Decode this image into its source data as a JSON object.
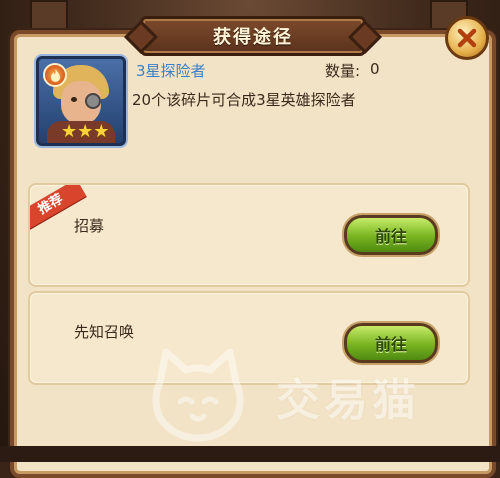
{
  "dialog": {
    "title": "获得途径",
    "close_icon": "close-x-icon"
  },
  "item": {
    "name": "3星探险者",
    "quantity_label": "数量:",
    "quantity_value": "0",
    "description": "20个该碎片可合成3星英雄探险者",
    "stars": 3,
    "element_icon": "fire-icon"
  },
  "sources": [
    {
      "label": "招募",
      "button": "前往",
      "recommended": true,
      "ribbon": "推荐"
    },
    {
      "label": "先知召唤",
      "button": "前往",
      "recommended": false
    }
  ],
  "watermark": {
    "text": "交易猫"
  },
  "colors": {
    "accent_blue": "#3a7fc8",
    "button_green": "#78b320",
    "ribbon_red": "#d8442c"
  }
}
